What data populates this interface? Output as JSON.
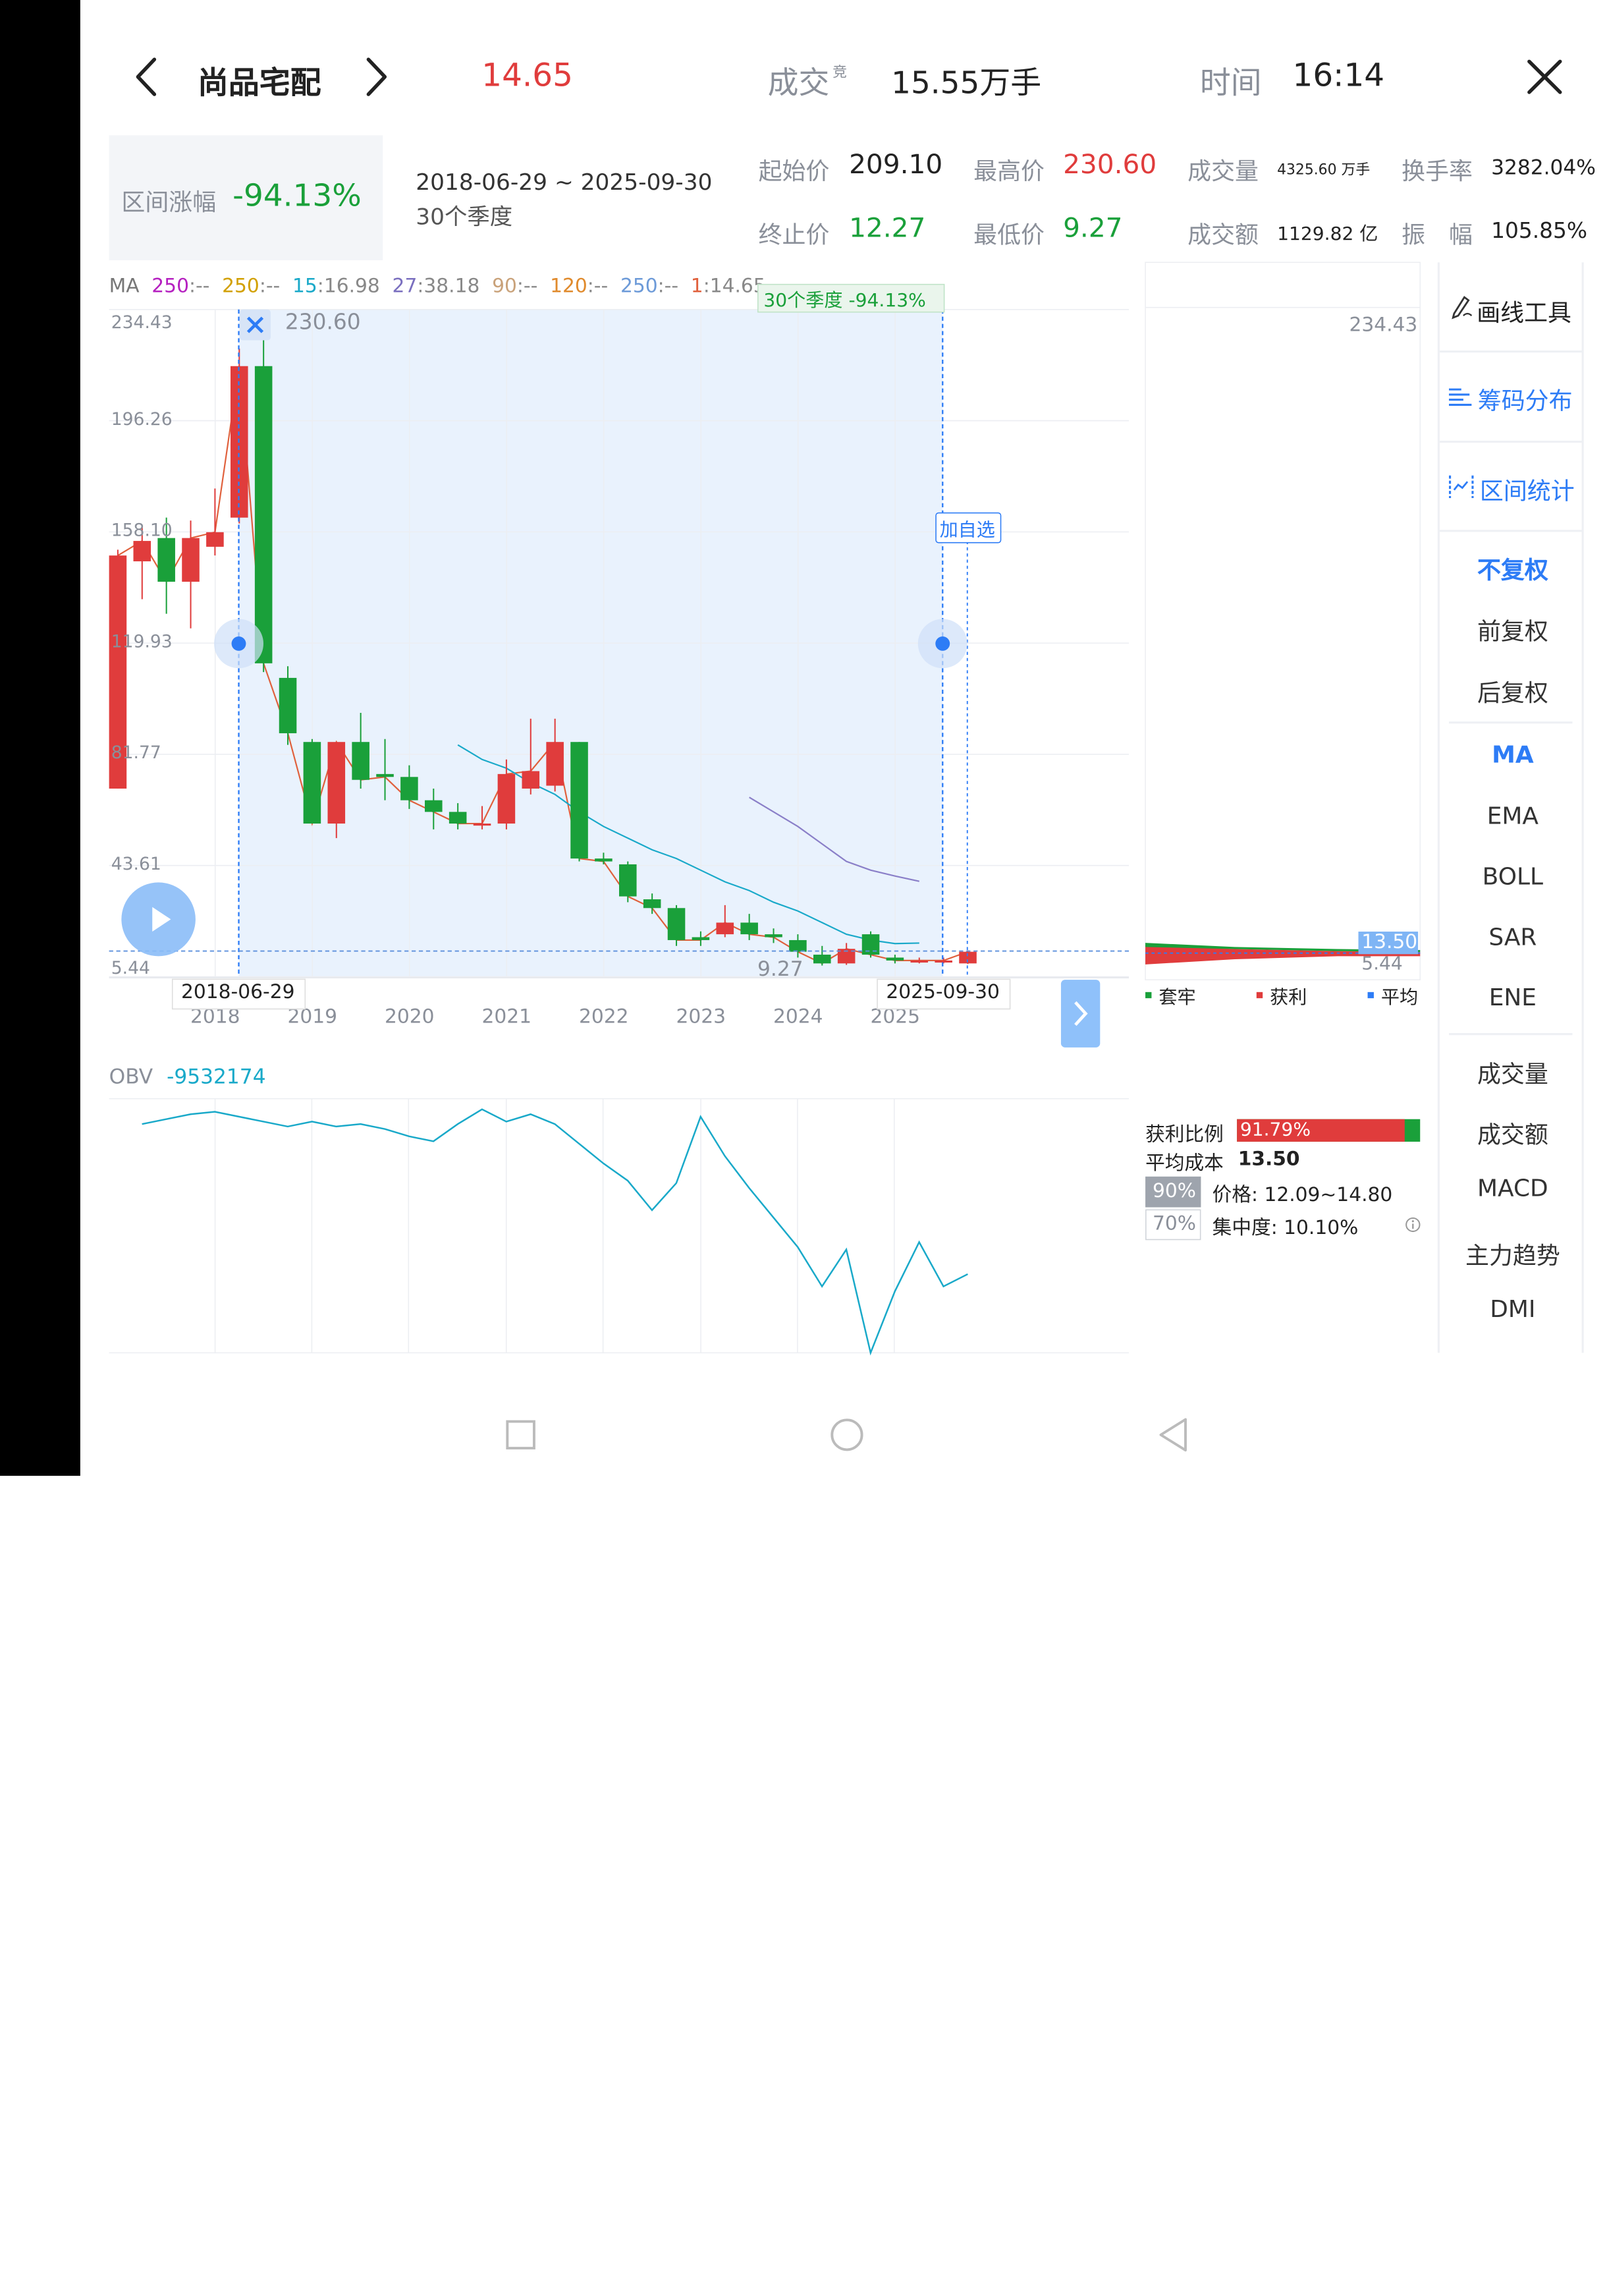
{
  "header": {
    "stock_name": "尚品宅配",
    "price": "14.65",
    "volume_label": "成交",
    "volume_sup": "竞",
    "volume_value": "15.55万手",
    "time_label": "时间",
    "time_value": "16:14"
  },
  "range": {
    "change_label": "区间涨幅",
    "change_value": "-94.13%",
    "dates": "2018-06-29 ~ 2025-09-30",
    "periods": "30个季度"
  },
  "stats": {
    "start_price_label": "起始价",
    "start_price": "209.10",
    "end_price_label": "终止价",
    "end_price": "12.27",
    "high_label": "最高价",
    "high": "230.60",
    "low_label": "最低价",
    "low": "9.27",
    "volume_label": "成交量",
    "volume": "4325.60 万手",
    "amount_label": "成交额",
    "amount": "1129.82 亿",
    "turnover_label": "换手率",
    "turnover": "3282.04%",
    "amplitude_label": "振　幅",
    "amplitude": "105.85%"
  },
  "ma_legend": [
    {
      "label": "MA",
      "value": "",
      "color": "#777777"
    },
    {
      "label": "250",
      "value": ":--",
      "color": "#b520c0"
    },
    {
      "label": "250",
      "value": ":--",
      "color": "#d2a000"
    },
    {
      "label": "15",
      "value": ":16.98",
      "color": "#19a9c9"
    },
    {
      "label": "27",
      "value": ":38.18",
      "color": "#7a6fbf"
    },
    {
      "label": "90",
      "value": ":--",
      "color": "#c9a27a"
    },
    {
      "label": "120",
      "value": ":--",
      "color": "#e08a2c"
    },
    {
      "label": "250",
      "value": ":--",
      "color": "#6c9ad8"
    },
    {
      "label": "1",
      "value": ":14.65",
      "color": "#e0603c"
    }
  ],
  "chart_labels": {
    "range_tag": "30个季度 -94.13%",
    "add_watch": "加自选",
    "high_marker": "230.60",
    "low_marker": "9.27",
    "start_date": "2018-06-29",
    "end_date": "2025-09-30"
  },
  "chip": {
    "top_price": "234.43",
    "avg_tag": "13.50",
    "bottom_price": "5.44",
    "legend": [
      "套牢",
      "获利",
      "平均"
    ],
    "profit_ratio_label": "获利比例",
    "profit_ratio": "91.79%",
    "profit_ratio_value": 0.9179,
    "avg_cost_label": "平均成本",
    "avg_cost": "13.50",
    "row90_tag": "90%",
    "row90_text": "价格: 12.09~14.80",
    "row70_tag": "70%",
    "row70_text": "集中度: 10.10%"
  },
  "obv": {
    "label": "OBV",
    "value": "-9532174"
  },
  "side_tools": {
    "draw": "画线工具",
    "chips": "筹码分布",
    "stats": "区间统计",
    "adjust": [
      "不复权",
      "前复权",
      "后复权"
    ],
    "main_indicators": [
      "MA",
      "EMA",
      "BOLL",
      "SAR",
      "ENE"
    ],
    "sub_indicators": [
      "成交量",
      "成交额",
      "MACD",
      "主力趋势",
      "DMI"
    ]
  },
  "colors": {
    "up": "#e03c3c",
    "down": "#1aa03a",
    "accent": "#2d7cf6",
    "obv": "#19a9c9"
  },
  "chart_data": [
    {
      "type": "candlestick",
      "ylim": [
        5.44,
        234.43
      ],
      "y_ticks": [
        "234.43",
        "196.26",
        "158.10",
        "119.93",
        "81.77",
        "43.61",
        "5.44"
      ],
      "x_ticks": [
        "2018",
        "2019",
        "2020",
        "2021",
        "2022",
        "2023",
        "2024",
        "2025"
      ],
      "x_tick_index": [
        4,
        8,
        12,
        16,
        20,
        24,
        28,
        32
      ],
      "candles": [
        {
          "o": 70.0,
          "c": 150.0,
          "h": 152.0,
          "l": 70.0
        },
        {
          "o": 148.0,
          "c": 155.0,
          "h": 160.0,
          "l": 135.0
        },
        {
          "o": 156.0,
          "c": 141.0,
          "h": 163.0,
          "l": 130.0
        },
        {
          "o": 141.0,
          "c": 156.0,
          "h": 162.0,
          "l": 125.0
        },
        {
          "o": 153.0,
          "c": 158.0,
          "h": 173.0,
          "l": 150.0
        },
        {
          "o": 163.0,
          "c": 215.0,
          "h": 221.0,
          "l": 161.0
        },
        {
          "o": 215.0,
          "c": 113.0,
          "h": 225.0,
          "l": 110.0
        },
        {
          "o": 108.0,
          "c": 89.0,
          "h": 112.0,
          "l": 85.0
        },
        {
          "o": 86.0,
          "c": 58.0,
          "h": 87.0,
          "l": 58.0
        },
        {
          "o": 58.0,
          "c": 86.0,
          "h": 86.0,
          "l": 53.0
        },
        {
          "o": 86.0,
          "c": 73.0,
          "h": 96.0,
          "l": 70.0
        },
        {
          "o": 75.0,
          "c": 74.0,
          "h": 87.0,
          "l": 66.0
        },
        {
          "o": 74.0,
          "c": 66.0,
          "h": 78.0,
          "l": 63.0
        },
        {
          "o": 66.0,
          "c": 62.0,
          "h": 70.0,
          "l": 56.0
        },
        {
          "o": 62.0,
          "c": 58.0,
          "h": 65.0,
          "l": 56.0
        },
        {
          "o": 58.0,
          "c": 58.0,
          "h": 64.0,
          "l": 56.0
        },
        {
          "o": 58.0,
          "c": 75.0,
          "h": 80.0,
          "l": 56.0
        },
        {
          "o": 70.0,
          "c": 76.0,
          "h": 94.0,
          "l": 68.0
        },
        {
          "o": 71.0,
          "c": 86.0,
          "h": 94.0,
          "l": 69.0
        },
        {
          "o": 86.0,
          "c": 46.0,
          "h": 86.0,
          "l": 45.0
        },
        {
          "o": 46.0,
          "c": 45.0,
          "h": 48.0,
          "l": 44.0
        },
        {
          "o": 44.0,
          "c": 33.0,
          "h": 45.0,
          "l": 31.0
        },
        {
          "o": 32.0,
          "c": 29.0,
          "h": 34.0,
          "l": 27.0
        },
        {
          "o": 29.0,
          "c": 18.0,
          "h": 30.0,
          "l": 16.0
        },
        {
          "o": 19.0,
          "c": 18.0,
          "h": 21.0,
          "l": 16.0
        },
        {
          "o": 20.0,
          "c": 24.0,
          "h": 30.0,
          "l": 19.0
        },
        {
          "o": 24.0,
          "c": 20.0,
          "h": 27.0,
          "l": 18.0
        },
        {
          "o": 20.0,
          "c": 19.0,
          "h": 22.0,
          "l": 17.0
        },
        {
          "o": 18.0,
          "c": 14.0,
          "h": 20.0,
          "l": 12.0
        },
        {
          "o": 13.0,
          "c": 10.0,
          "h": 16.0,
          "l": 9.27
        },
        {
          "o": 10.0,
          "c": 15.0,
          "h": 17.0,
          "l": 9.5
        },
        {
          "o": 20.0,
          "c": 13.0,
          "h": 21.0,
          "l": 12.0
        },
        {
          "o": 12.0,
          "c": 11.0,
          "h": 13.0,
          "l": 10.0
        },
        {
          "o": 11.0,
          "c": 11.0,
          "h": 12.0,
          "l": 10.0
        },
        {
          "o": 11.0,
          "c": 11.0,
          "h": 12.0,
          "l": 10.0
        },
        {
          "o": 10.0,
          "c": 14.0,
          "h": 14.5,
          "l": 9.8
        }
      ],
      "ma15": [
        null,
        null,
        null,
        null,
        null,
        null,
        null,
        null,
        null,
        null,
        null,
        null,
        null,
        null,
        85.0,
        80.0,
        77.0,
        72.0,
        68.0,
        62.0,
        57.0,
        53.0,
        49.0,
        46.0,
        42.0,
        38.0,
        35.0,
        31.0,
        28.0,
        24.0,
        20.0,
        18.0,
        16.8,
        16.98
      ],
      "ma27": [
        null,
        null,
        null,
        null,
        null,
        null,
        null,
        null,
        null,
        null,
        null,
        null,
        null,
        null,
        null,
        null,
        null,
        null,
        null,
        null,
        null,
        null,
        null,
        null,
        null,
        null,
        67.0,
        62.0,
        57.0,
        51.0,
        45.0,
        42.0,
        40.0,
        38.18
      ]
    },
    {
      "type": "line",
      "name": "OBV",
      "values": [
        0.93,
        0.95,
        0.97,
        0.98,
        0.96,
        0.94,
        0.92,
        0.94,
        0.92,
        0.93,
        0.91,
        0.88,
        0.86,
        0.93,
        0.99,
        0.94,
        0.97,
        0.93,
        0.85,
        0.77,
        0.7,
        0.58,
        0.69,
        0.96,
        0.8,
        0.67,
        0.55,
        0.43,
        0.27,
        0.42,
        0.0,
        0.25,
        0.45,
        0.27,
        0.32
      ]
    }
  ]
}
